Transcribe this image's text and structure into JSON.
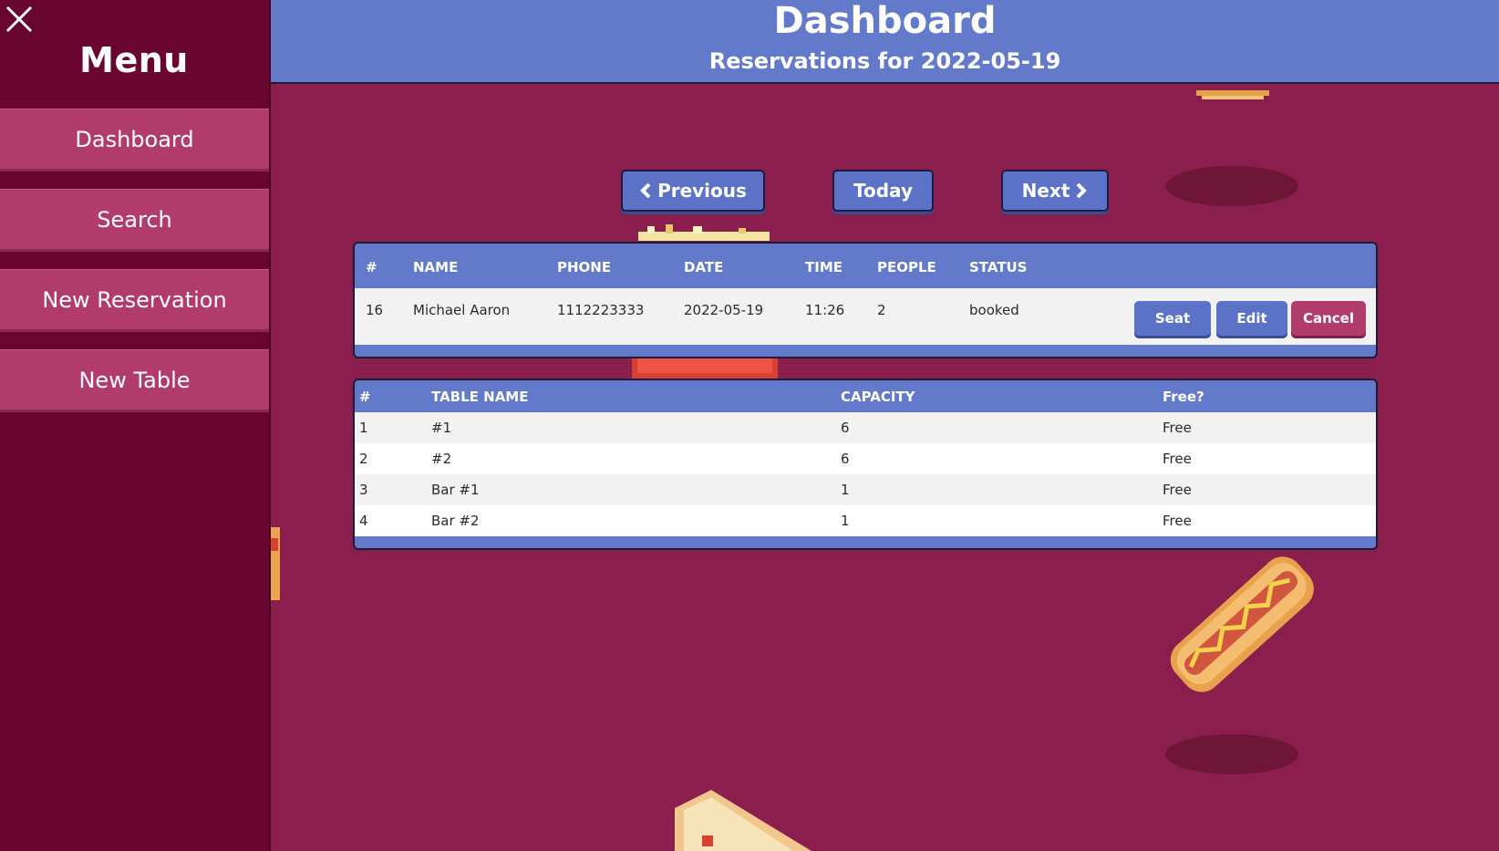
{
  "sidebar": {
    "title": "Menu",
    "close_icon": "close-icon",
    "items": [
      {
        "label": "Dashboard"
      },
      {
        "label": "Search"
      },
      {
        "label": "New Reservation"
      },
      {
        "label": "New Table"
      }
    ]
  },
  "header": {
    "title": "Dashboard",
    "subtitle": "Reservations for 2022-05-19"
  },
  "date_nav": {
    "previous_label": "Previous",
    "today_label": "Today",
    "next_label": "Next"
  },
  "reservations": {
    "columns": [
      "#",
      "NAME",
      "PHONE",
      "DATE",
      "TIME",
      "PEOPLE",
      "STATUS"
    ],
    "rows": [
      {
        "id": "16",
        "name": "Michael Aaron",
        "phone": "1112223333",
        "date": "2022-05-19",
        "time": "11:26",
        "people": "2",
        "status": "booked",
        "actions": {
          "seat": "Seat",
          "edit": "Edit",
          "cancel": "Cancel"
        }
      }
    ]
  },
  "tables": {
    "columns": [
      "#",
      "TABLE NAME",
      "CAPACITY",
      "Free?"
    ],
    "rows": [
      {
        "id": "1",
        "name": "#1",
        "capacity": "6",
        "free": "Free"
      },
      {
        "id": "2",
        "name": "#2",
        "capacity": "6",
        "free": "Free"
      },
      {
        "id": "3",
        "name": "Bar #1",
        "capacity": "1",
        "free": "Free"
      },
      {
        "id": "4",
        "name": "Bar #2",
        "capacity": "1",
        "free": "Free"
      }
    ]
  },
  "colors": {
    "background": "#8a1f4e",
    "sidebar": "#69062f",
    "nav_item": "#b13c6c",
    "header": "#6379c9",
    "button_blue": "#5b72c6",
    "button_pink": "#b13c6c"
  }
}
